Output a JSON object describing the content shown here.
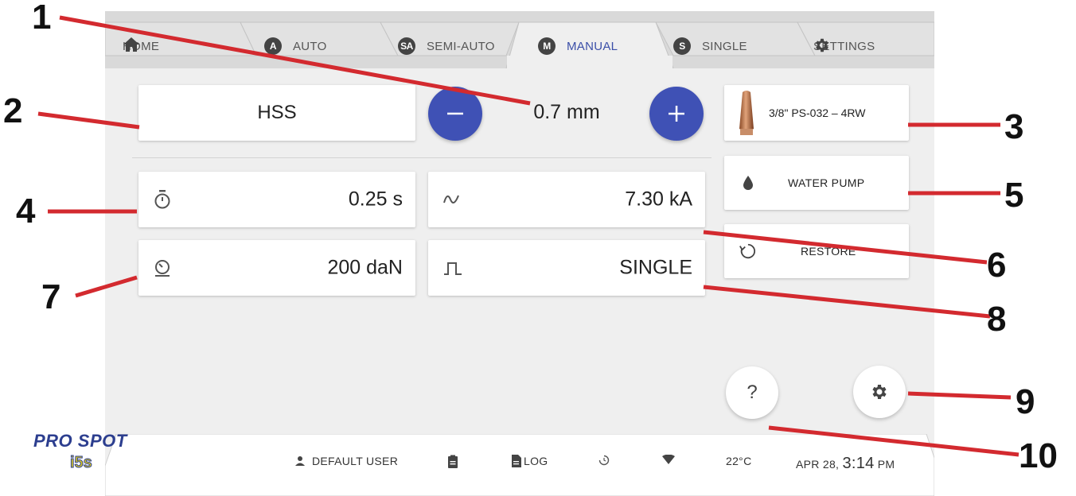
{
  "tabs": [
    {
      "label": "HOME",
      "badge": ""
    },
    {
      "label": "AUTO",
      "badge": "A"
    },
    {
      "label": "SEMI-AUTO",
      "badge": "SA"
    },
    {
      "label": "MANUAL",
      "badge": "M"
    },
    {
      "label": "SINGLE",
      "badge": "S"
    },
    {
      "label": "SETTINGS",
      "badge": ""
    }
  ],
  "active_tab": "MANUAL",
  "material": "HSS",
  "thickness": "0.7 mm",
  "electrode": "3/8\" PS-032 – 4RW",
  "water_pump": "WATER PUMP",
  "restore": "RESTORE",
  "time": "0.25 s",
  "current": "7.30 kA",
  "force": "200 daN",
  "pulse": "SINGLE",
  "help_label": "?",
  "footer": {
    "logo": "PRO SPOT",
    "logo_sub": "i5s",
    "user": "DEFAULT USER",
    "log": "LOG",
    "temperature": "22°C",
    "date": "APR 28,",
    "time": "3:14",
    "ampm": "PM"
  },
  "annotations": [
    "1",
    "2",
    "3",
    "4",
    "5",
    "6",
    "7",
    "8",
    "9",
    "10"
  ],
  "colors": {
    "accent": "#3f51b5",
    "active_tab_text": "#3b4fa8",
    "annotation_line": "#d32a2f",
    "tab_bg": "#dcdcdc",
    "screen_bg": "#efefef"
  }
}
